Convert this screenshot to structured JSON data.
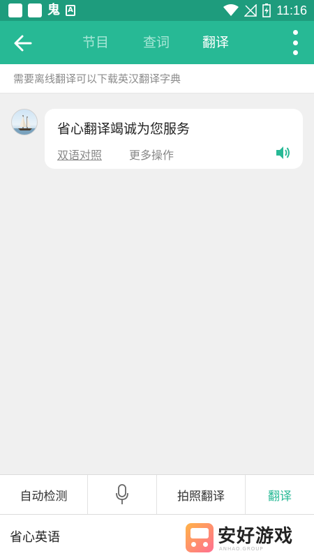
{
  "status_bar": {
    "ghost_text": "鬼",
    "a_text": "A",
    "time": "11:16"
  },
  "app_bar": {
    "tabs": [
      {
        "label": "节目"
      },
      {
        "label": "查词"
      },
      {
        "label": "翻译",
        "active": true
      }
    ]
  },
  "notice": "需要离线翻译可以下载英汉翻译字典",
  "message": {
    "text": "省心翻译竭诚为您服务",
    "link": "双语对照",
    "more": "更多操作"
  },
  "bottom_bar": {
    "auto_detect": "自动检测",
    "photo_translate": "拍照翻译",
    "translate": "翻译"
  },
  "footer": {
    "name": "省心英语",
    "watermark_text": "安好游戏",
    "watermark_sub": "ANHAO.GROUP"
  },
  "colors": {
    "status_bar": "#1e9c7d",
    "app_bar": "#27b995",
    "accent": "#27b995"
  }
}
